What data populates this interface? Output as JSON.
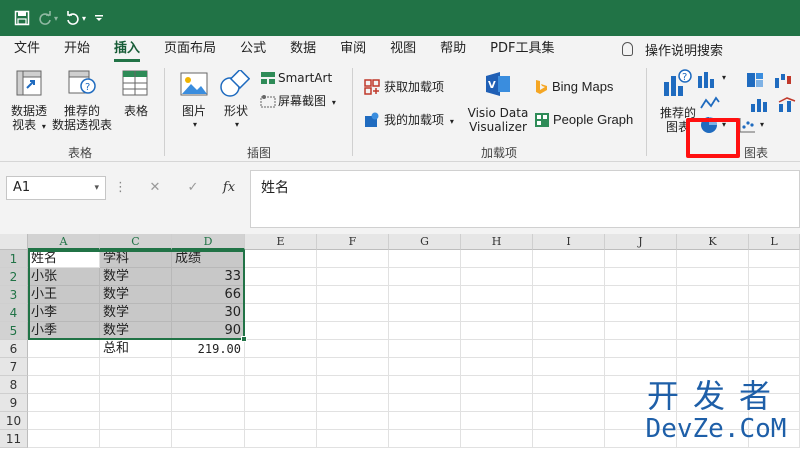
{
  "colors": {
    "accent": "#217346",
    "highlight": "#ff1010",
    "watermark": "#1e5fa8"
  },
  "quick_access": {
    "save_icon": "save-icon",
    "redo_icon": "redo-icon",
    "undo_icon": "undo-icon",
    "customize_icon": "customize-icon"
  },
  "menu": {
    "tabs": [
      "文件",
      "开始",
      "插入",
      "页面布局",
      "公式",
      "数据",
      "审阅",
      "视图",
      "帮助",
      "PDF工具集"
    ],
    "active_tab": "插入",
    "search_label": "操作说明搜索"
  },
  "ribbon": {
    "tables": {
      "pivot_line1": "数据透",
      "pivot_line2": "视表",
      "rec_pivot_line1": "推荐的",
      "rec_pivot_line2": "数据透视表",
      "table": "表格",
      "group": "表格"
    },
    "illustrations": {
      "pictures": "图片",
      "shapes": "形状",
      "smartart": "SmartArt",
      "screenshot": "屏幕截图",
      "group": "插图"
    },
    "addins": {
      "get_addins": "获取加载项",
      "my_addins": "我的加载项",
      "visio_line1": "Visio Data",
      "visio_line2": "Visualizer",
      "bing_maps": "Bing Maps",
      "people_graph": "People Graph",
      "group": "加载项"
    },
    "charts": {
      "rec_line1": "推荐的",
      "rec_line2": "图表",
      "group": "图表"
    }
  },
  "formula_bar": {
    "name_box": "A1",
    "fx": "fx",
    "content": "姓名"
  },
  "grid": {
    "columns": [
      "A",
      "C",
      "D",
      "E",
      "F",
      "G",
      "H",
      "I",
      "J",
      "K",
      "L"
    ],
    "rows": [
      "1",
      "2",
      "3",
      "4",
      "5",
      "6",
      "7",
      "8",
      "9",
      "10",
      "11"
    ],
    "cells": [
      [
        "姓名",
        "学科",
        "成绩"
      ],
      [
        "小张",
        "数学",
        "33"
      ],
      [
        "小王",
        "数学",
        "66"
      ],
      [
        "小李",
        "数学",
        "30"
      ],
      [
        "小季",
        "数学",
        "90"
      ],
      [
        "",
        "总和",
        "219.00"
      ]
    ]
  },
  "watermark": {
    "line1": "开发者",
    "line2": "DevZe.CoM"
  }
}
